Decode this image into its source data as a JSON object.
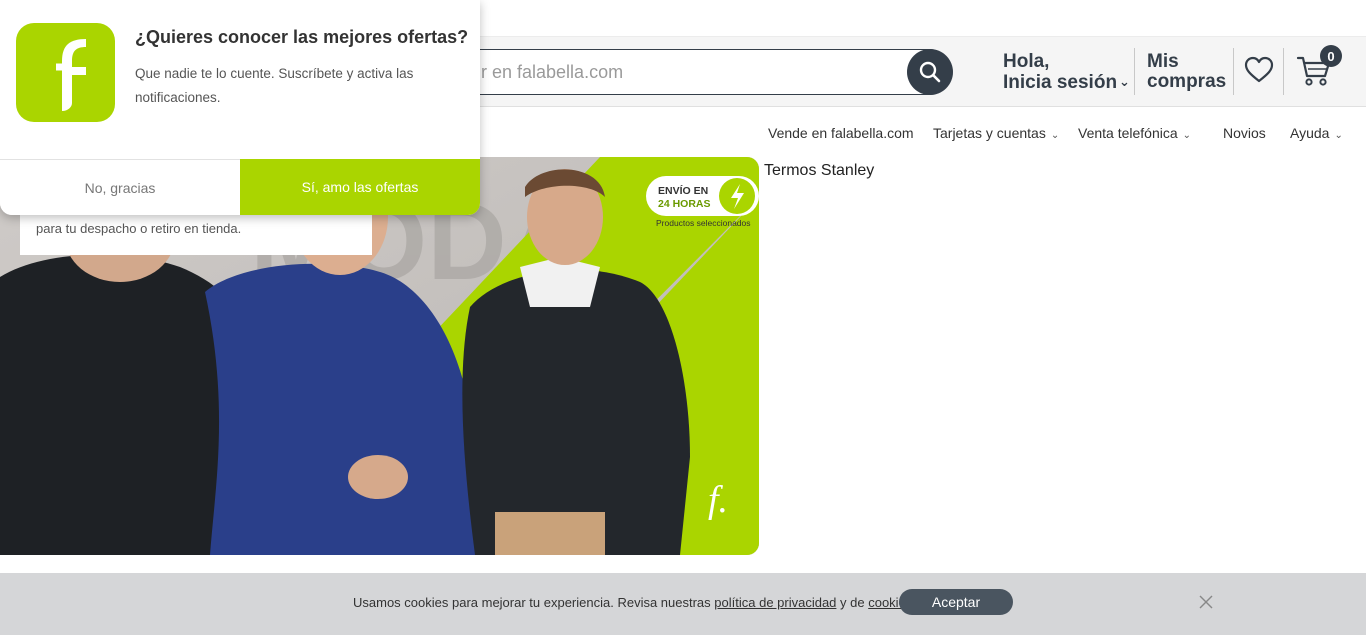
{
  "popup": {
    "title": "¿Quieres conocer las mejores ofertas?",
    "body": "Que nadie te lo cuente. Suscríbete y activa las notificaciones.",
    "no_label": "No, gracias",
    "yes_label": "Sí, amo las ofertas",
    "logo_letter": "f",
    "brand_color": "#aad500"
  },
  "header": {
    "search_placeholder": "r en falabella.com",
    "greeting_line1": "Hola,",
    "greeting_line2": "Inicia sesión",
    "purchases_line1": "Mis",
    "purchases_line2": "compras",
    "cart_count": "0"
  },
  "nav": {
    "items": [
      {
        "label": "Vende en falabella.com",
        "has_caret": false
      },
      {
        "label": "Tarjetas y cuentas",
        "has_caret": true
      },
      {
        "label": "Venta telefónica",
        "has_caret": true
      },
      {
        "label": "Novios",
        "has_caret": false
      },
      {
        "label": "Ayuda",
        "has_caret": true
      }
    ]
  },
  "banner": {
    "shipping_line1": "ENVÍO EN",
    "shipping_line2": "24 HORAS",
    "shipping_note": "Productos seleccionados",
    "bg_word": "MODA",
    "logo_letter": "f."
  },
  "despacho_text": "para tu despacho o retiro en tienda.",
  "sidebar_link": "Termos Stanley",
  "cookies": {
    "text_before": "Usamos cookies para mejorar tu experiencia. Revisa nuestras ",
    "privacy_link": "política de privacidad",
    "text_middle": " y de ",
    "cookies_link": "cookies",
    "text_after": ".",
    "accept_label": "Aceptar"
  }
}
